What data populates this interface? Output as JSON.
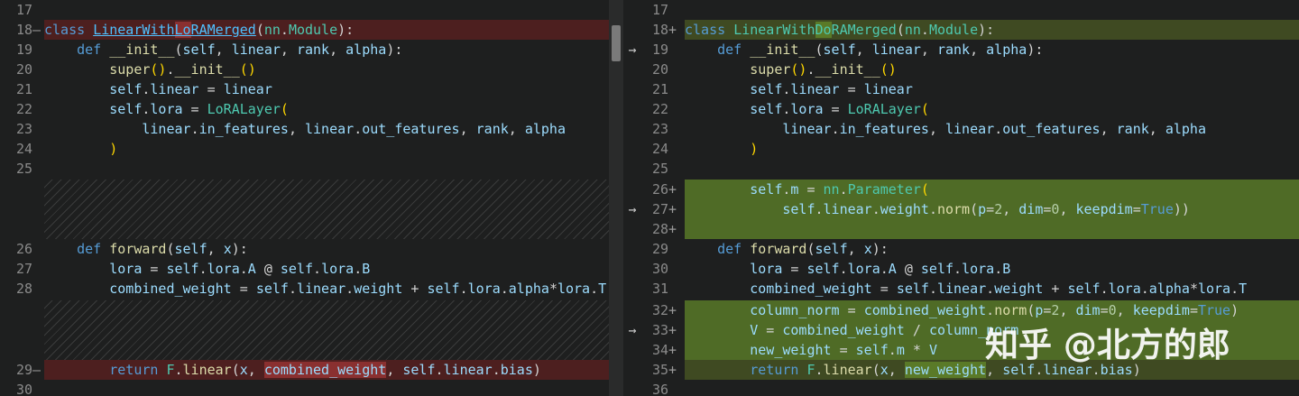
{
  "left": {
    "lines": [
      {
        "n": "17",
        "code": ""
      },
      {
        "n": "18",
        "code": "class LinearWithLoRAMerged(nn.Module):"
      },
      {
        "n": "19",
        "code": "    def __init__(self, linear, rank, alpha):"
      },
      {
        "n": "20",
        "code": "        super().__init__()"
      },
      {
        "n": "21",
        "code": "        self.linear = linear"
      },
      {
        "n": "22",
        "code": "        self.lora = LoRALayer("
      },
      {
        "n": "23",
        "code": "            linear.in_features, linear.out_features, rank, alpha"
      },
      {
        "n": "24",
        "code": "        )"
      },
      {
        "n": "25",
        "code": ""
      },
      {
        "n": "26",
        "code": "    def forward(self, x):"
      },
      {
        "n": "27",
        "code": "        lora = self.lora.A @ self.lora.B"
      },
      {
        "n": "28",
        "code": "        combined_weight = self.linear.weight + self.lora.alpha*lora.T"
      },
      {
        "n": "29",
        "code": "        return F.linear(x, combined_weight, self.linear.bias)"
      },
      {
        "n": "30",
        "code": ""
      }
    ]
  },
  "right": {
    "lines": [
      {
        "n": "17",
        "code": ""
      },
      {
        "n": "18",
        "code": "class LinearWithDoRAMerged(nn.Module):"
      },
      {
        "n": "19",
        "code": "    def __init__(self, linear, rank, alpha):"
      },
      {
        "n": "20",
        "code": "        super().__init__()"
      },
      {
        "n": "21",
        "code": "        self.linear = linear"
      },
      {
        "n": "22",
        "code": "        self.lora = LoRALayer("
      },
      {
        "n": "23",
        "code": "            linear.in_features, linear.out_features, rank, alpha"
      },
      {
        "n": "24",
        "code": "        )"
      },
      {
        "n": "25",
        "code": ""
      },
      {
        "n": "26",
        "code": "        self.m = nn.Parameter("
      },
      {
        "n": "27",
        "code": "            self.linear.weight.norm(p=2, dim=0, keepdim=True))"
      },
      {
        "n": "28",
        "code": ""
      },
      {
        "n": "29",
        "code": "    def forward(self, x):"
      },
      {
        "n": "30",
        "code": "        lora = self.lora.A @ self.lora.B"
      },
      {
        "n": "31",
        "code": "        combined_weight = self.linear.weight + self.lora.alpha*lora.T"
      },
      {
        "n": "32",
        "code": "        column_norm = combined_weight.norm(p=2, dim=0, keepdim=True)"
      },
      {
        "n": "33",
        "code": "        V = combined_weight / column_norm"
      },
      {
        "n": "34",
        "code": "        new_weight = self.m * V"
      },
      {
        "n": "35",
        "code": "        return F.linear(x, new_weight, self.linear.bias)"
      },
      {
        "n": "36",
        "code": ""
      }
    ]
  },
  "markers": {
    "minus": "—",
    "plus": "+",
    "arrow": "→"
  },
  "watermark": "知乎 @北方的郎"
}
